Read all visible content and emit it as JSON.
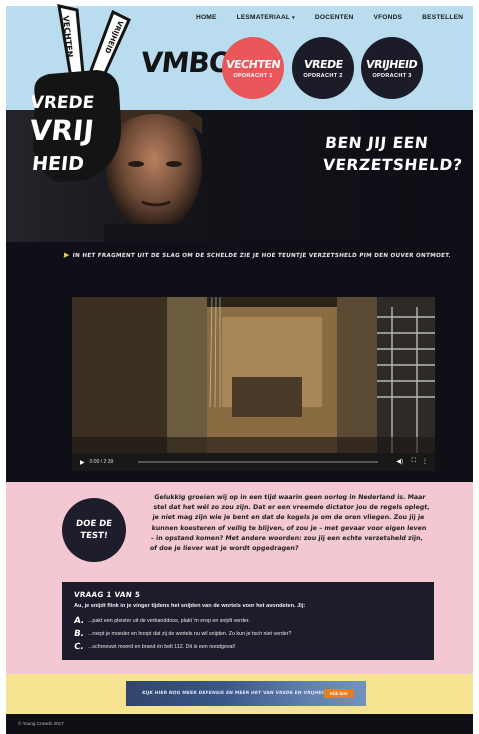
{
  "nav": {
    "items": [
      "HOME",
      "LESMATERIAAL",
      "DOCENTEN",
      "VFONDS",
      "BESTELLEN"
    ],
    "dropdown_caret": "▾"
  },
  "logo": {
    "words": [
      "VECHTEN",
      "VRIJHEID",
      "VREDE",
      "VRIJ",
      "HEID"
    ],
    "icon": "peace-hand-icon"
  },
  "site_title": "VMBO",
  "assignments": [
    {
      "title": "VECHTEN",
      "label": "OPDRACHT 1",
      "color": "#e9575a"
    },
    {
      "title": "VREDE",
      "label": "OPDRACHT 2",
      "color": "#1c1c28"
    },
    {
      "title": "VRIJHEID",
      "label": "OPDRACHT 3",
      "color": "#1c1c28"
    }
  ],
  "hero": {
    "title_line1": "BEN JIJ EEN",
    "title_line2": "VERZETSHELD?"
  },
  "video_section": {
    "intro_icon": "play-triangle-icon",
    "intro": "IN HET FRAGMENT UIT DE SLAG OM DE SCHELDE ZIE JE HOE TEUNTJE VERZETSHELD PIM DEN OUVER ONTMOET.",
    "player": {
      "time": "0:00 / 2:39",
      "progress": 0
    }
  },
  "quiz": {
    "test_label_line1": "DOE DE",
    "test_label_line2": "TEST!",
    "intro": "Gelukkig groeien wij op in een tijd waarin geen oorlog in Nederland is. Maar stel dat het wél zo zou zijn. Dat er een vreemde dictator jou de regels oplegt, je niet mag zijn wie je bent en dat de kogels je om de oren vliegen. Zou jij je kunnen koesteren of veilig te blijven, of zou je – met gevaar voor eigen leven – in opstand komen? Met andere woorden: zou jij een echte verzetsheld zijn, of doe je liever wat je wordt opgedragen?",
    "question_head": "VRAAG 1 VAN 5",
    "question": "Au, je snijdt flink in je vinger tijdens het snijden van de wortels voor het avondeten. Jij:",
    "answers": [
      {
        "letter": "A.",
        "text": "...pakt een pleister uit de verbanddoos, plakt 'm erop en snijdt verder."
      },
      {
        "letter": "B.",
        "text": "...roept je moeder en hoopt dat zij de wortels nu wil snijden. Zo kun je toch niet verder?"
      },
      {
        "letter": "C.",
        "text": "...schreeuwt moord en brand én belt 112. Dit is een noodgeval!"
      }
    ]
  },
  "banner": {
    "text": "KIJK HIER NOG MEER DEFENSIE EN MEER HET VAN VREDE EN VRIJHEID",
    "button": "Klik hier"
  },
  "footer": {
    "copyright": "© Young Crowds 2017"
  }
}
